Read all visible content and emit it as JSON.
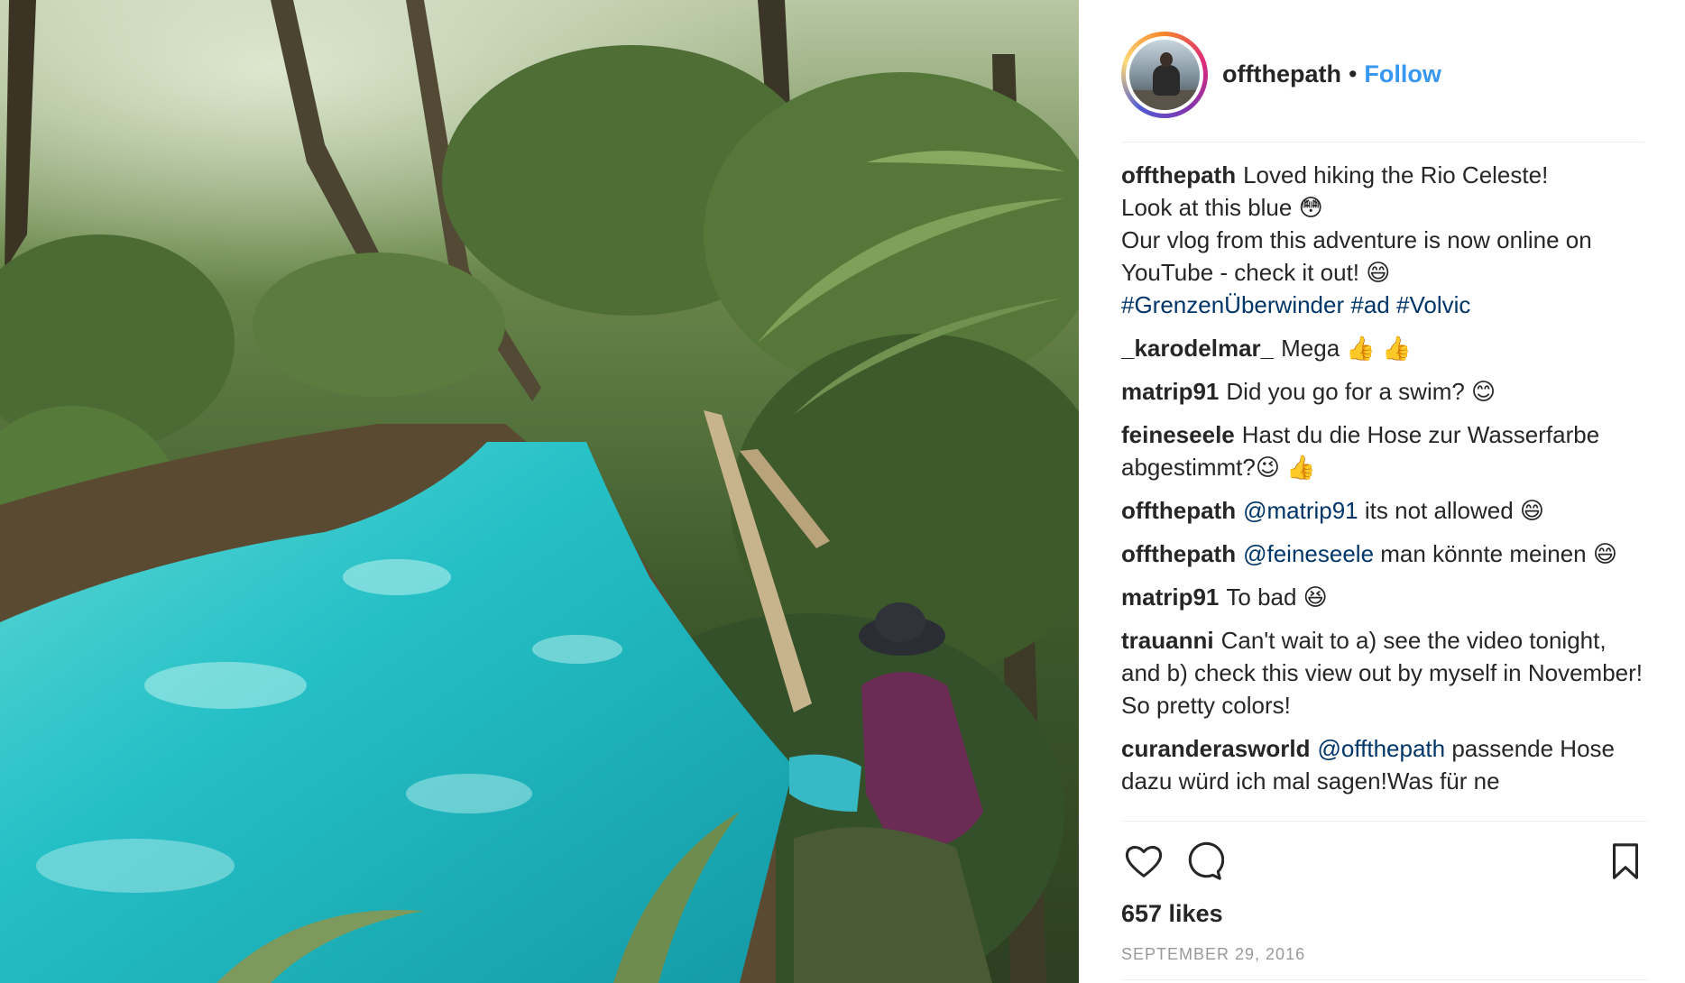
{
  "post": {
    "username": "offthepath",
    "separator": "•",
    "follow_label": "Follow",
    "image_icon": "photo-of-turquoise-river-in-rainforest"
  },
  "caption": {
    "user": "offthepath",
    "line1": "Loved hiking the Rio Celeste!",
    "line2": "Look at this blue 😳",
    "line3": "Our vlog from this adventure is now online on YouTube - check it out! 😄",
    "hashtags": [
      "#GrenzenÜberwinder",
      "#ad",
      "#Volvic"
    ]
  },
  "comments": [
    {
      "user": "_karodelmar_",
      "text": "Mega 👍 👍"
    },
    {
      "user": "matrip91",
      "text": "Did you go for a swim? 😊"
    },
    {
      "user": "feineseele",
      "text": "Hast du die Hose zur Wasserfarbe abgestimmt?😉 👍"
    },
    {
      "user": "offthepath",
      "mention": "@matrip91",
      "text": "its not allowed 😄"
    },
    {
      "user": "offthepath",
      "mention": "@feineseele",
      "text": "man könnte meinen 😄"
    },
    {
      "user": "matrip91",
      "text": "To bad 😆"
    },
    {
      "user": "trauanni",
      "text": "Can't wait to a) see the video tonight, and b) check this view out by myself in November! So pretty colors!"
    },
    {
      "user": "curanderasworld",
      "mention": "@offthepath",
      "text": "passende Hose dazu würd ich mal sagen!Was für ne"
    }
  ],
  "actions": {
    "like_icon": "heart-icon",
    "comment_icon": "comment-bubble-icon",
    "save_icon": "bookmark-icon"
  },
  "likes": "657 likes",
  "date": "SEPTEMBER 29, 2016",
  "colors": {
    "link_blue": "#3897f0",
    "hashtag": "#003569",
    "text": "#262626",
    "muted": "#999999",
    "river": "#2cc6c8"
  }
}
